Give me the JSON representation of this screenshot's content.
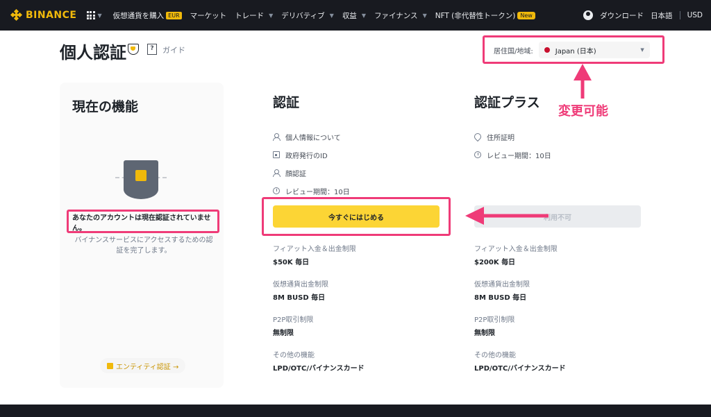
{
  "nav": {
    "logo_text": "BINANCE",
    "items": [
      {
        "label": "仮想通貨を購入",
        "badge": "EUR"
      },
      {
        "label": "マーケット"
      },
      {
        "label": "トレード"
      },
      {
        "label": "デリバティブ"
      },
      {
        "label": "収益"
      },
      {
        "label": "ファイナンス"
      },
      {
        "label": "NFT (非代替性トークン)",
        "badge": "New"
      }
    ],
    "download": "ダウンロード",
    "language": "日本語",
    "currency": "USD"
  },
  "header": {
    "title": "個人認証",
    "guide": "ガイド",
    "residence_label": "居住国/地域:",
    "residence_value": "Japan (日本)"
  },
  "left_card": {
    "title": "現在の機能",
    "status": "あなたのアカウントは現在認証されていません。",
    "description": "バイナンスサービスにアクセスするための認証を完了します。",
    "entity_link": "エンティティ認証 →"
  },
  "verified": {
    "title": "認証",
    "requirements": [
      "個人情報について",
      "政府発行のID",
      "顔認証",
      "レビュー期間：10日"
    ],
    "button": "今すぐにはじめる",
    "limits": [
      {
        "label": "フィアット入金＆出金制限",
        "value": "$50K 毎日"
      },
      {
        "label": "仮想通貨出金制限",
        "value": "8M BUSD 毎日"
      },
      {
        "label": "P2P取引制限",
        "value": "無制限"
      },
      {
        "label": "その他の機能",
        "value": "LPD/OTC/バイナンスカード"
      }
    ]
  },
  "verified_plus": {
    "title": "認証プラス",
    "requirements": [
      "住所証明",
      "レビュー期間：10日"
    ],
    "button": "利用不可",
    "limits": [
      {
        "label": "フィアット入金＆出金制限",
        "value": "$200K 毎日"
      },
      {
        "label": "仮想通貨出金制限",
        "value": "8M BUSD 毎日"
      },
      {
        "label": "P2P取引制限",
        "value": "無制限"
      },
      {
        "label": "その他の機能",
        "value": "LPD/OTC/バイナンスカード"
      }
    ]
  },
  "annotation": {
    "text": "変更可能",
    "color": "#ef3b78"
  },
  "colors": {
    "brand": "#f0b90b",
    "button": "#fcd535",
    "nav_bg": "#181a20"
  }
}
